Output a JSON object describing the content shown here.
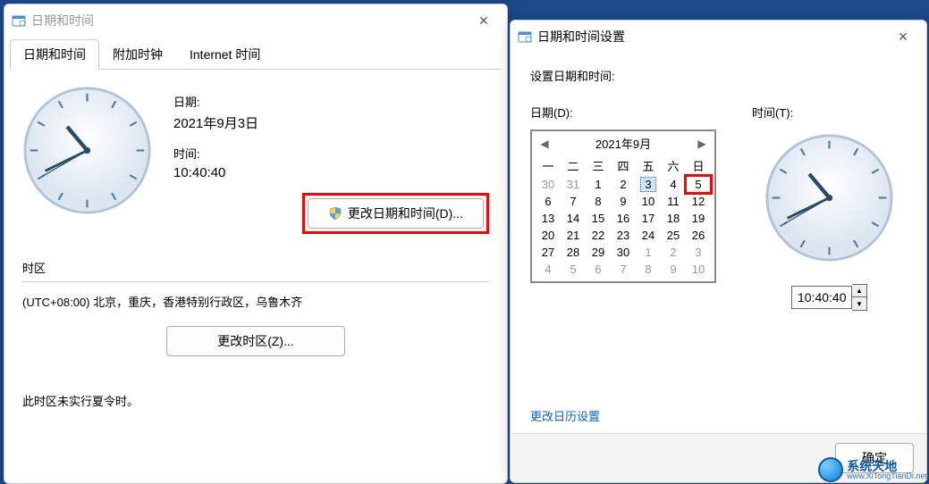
{
  "win1": {
    "title": "日期和时间",
    "tabs": [
      "日期和时间",
      "附加时钟",
      "Internet 时间"
    ],
    "active_tab": 0,
    "date_label": "日期:",
    "date_value": "2021年9月3日",
    "time_label": "时间:",
    "time_value": "10:40:40",
    "change_dt_btn": "更改日期和时间(D)...",
    "tz_label": "时区",
    "tz_value": "(UTC+08:00) 北京，重庆，香港特别行政区，乌鲁木齐",
    "change_tz_btn": "更改时区(Z)...",
    "dst_note": "此时区未实行夏令时。"
  },
  "win2": {
    "title": "日期和时间设置",
    "set_label": "设置日期和时间:",
    "date_col_label": "日期(D):",
    "time_col_label": "时间(T):",
    "month_label": "2021年9月",
    "weekday_headers": [
      "一",
      "二",
      "三",
      "四",
      "五",
      "六",
      "日"
    ],
    "days": [
      {
        "n": "30",
        "other": true
      },
      {
        "n": "31",
        "other": true
      },
      {
        "n": "1"
      },
      {
        "n": "2"
      },
      {
        "n": "3",
        "selected": true
      },
      {
        "n": "4"
      },
      {
        "n": "5",
        "redbox": true
      },
      {
        "n": "6"
      },
      {
        "n": "7"
      },
      {
        "n": "8"
      },
      {
        "n": "9"
      },
      {
        "n": "10"
      },
      {
        "n": "11"
      },
      {
        "n": "12"
      },
      {
        "n": "13"
      },
      {
        "n": "14"
      },
      {
        "n": "15"
      },
      {
        "n": "16"
      },
      {
        "n": "17"
      },
      {
        "n": "18"
      },
      {
        "n": "19"
      },
      {
        "n": "20"
      },
      {
        "n": "21"
      },
      {
        "n": "22"
      },
      {
        "n": "23"
      },
      {
        "n": "24"
      },
      {
        "n": "25"
      },
      {
        "n": "26"
      },
      {
        "n": "27"
      },
      {
        "n": "28"
      },
      {
        "n": "29"
      },
      {
        "n": "30"
      },
      {
        "n": "1",
        "other": true
      },
      {
        "n": "2",
        "other": true
      },
      {
        "n": "3",
        "other": true
      },
      {
        "n": "4",
        "other": true
      },
      {
        "n": "5",
        "other": true
      },
      {
        "n": "6",
        "other": true
      },
      {
        "n": "7",
        "other": true
      },
      {
        "n": "8",
        "other": true
      },
      {
        "n": "9",
        "other": true
      },
      {
        "n": "10",
        "other": true
      }
    ],
    "time_value": "10:40:40",
    "link": "更改日历设置",
    "ok_btn": "确定"
  },
  "clock": {
    "hour_angle": 320,
    "minute_angle": 244,
    "second_angle": 240
  },
  "watermark": {
    "cn": "系统天地",
    "en": "www.XiTongTianDi.net"
  }
}
